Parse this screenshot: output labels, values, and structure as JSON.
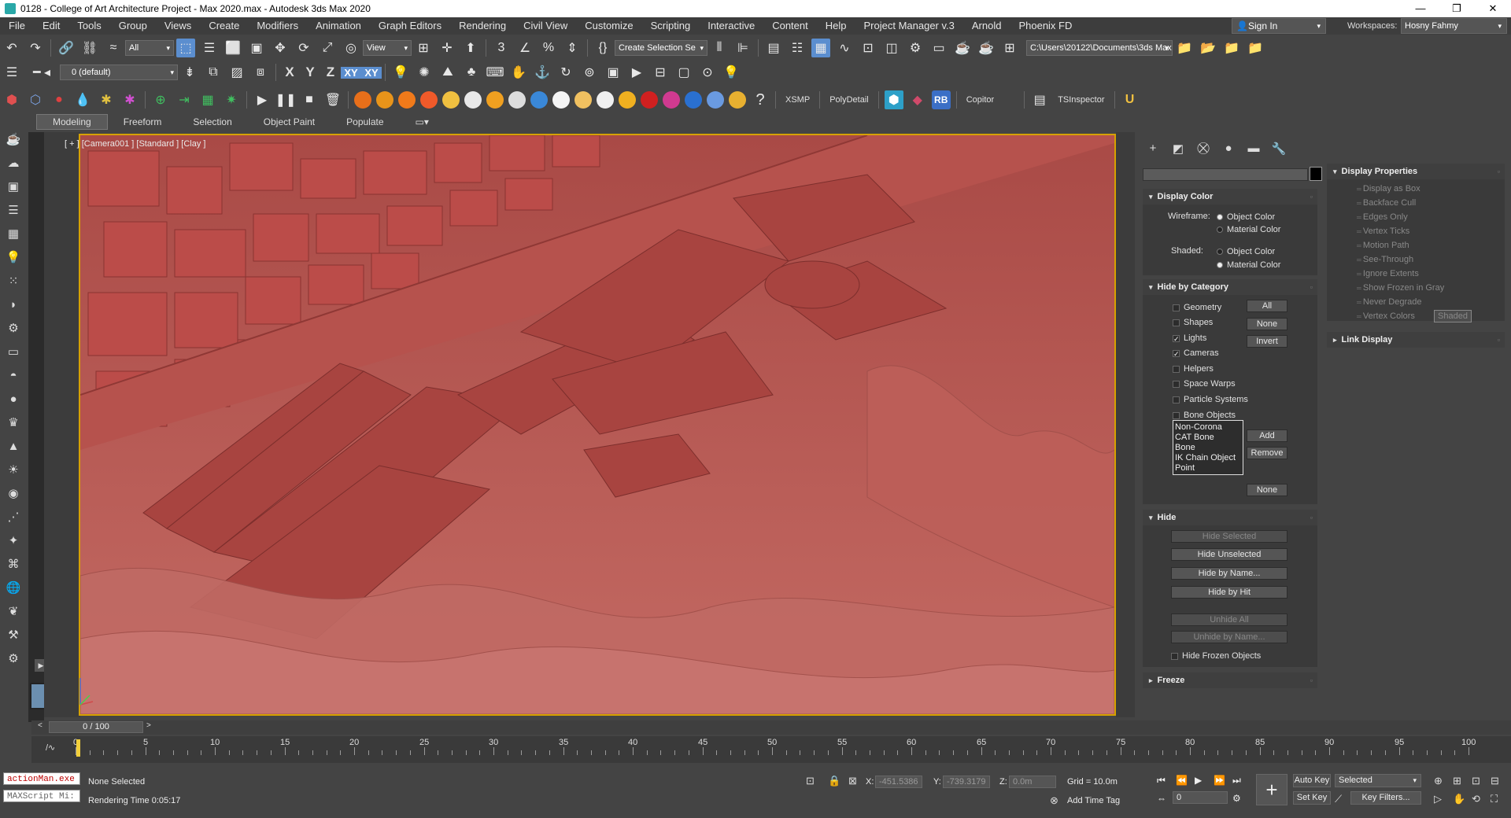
{
  "window": {
    "title": "0128 - College of Art Architecture Project - Max 2020.max - Autodesk 3ds Max 2020",
    "minimize": "—",
    "maximize": "❐",
    "close": "✕"
  },
  "menu": [
    "File",
    "Edit",
    "Tools",
    "Group",
    "Views",
    "Create",
    "Modifiers",
    "Animation",
    "Graph Editors",
    "Rendering",
    "Civil View",
    "Customize",
    "Scripting",
    "Interactive",
    "Content",
    "Help",
    "Project Manager v.3",
    "Arnold",
    "Phoenix FD"
  ],
  "account": {
    "sign_in": "Sign In",
    "workspaces_label": "Workspaces:",
    "workspace": "Hosny Fahmy"
  },
  "toolbar1": {
    "selection_filter": "All",
    "ref_coord": "View",
    "named_selection": "Create Selection Se",
    "project_path": "C:\\Users\\20122\\Documents\\3ds Max 2020"
  },
  "toolbar2": {
    "layer": "0 (default)",
    "axis_x": "X",
    "axis_y": "Y",
    "axis_z": "Z",
    "axis_xy": "XY",
    "axis_xy2": "XY"
  },
  "toolbar3": {
    "xsmp": "XSMP",
    "polydetail": "PolyDetail",
    "rb": "RB",
    "copitor": "Copitor",
    "tsinspector": "TSInspector"
  },
  "ribbon_tabs": [
    "Modeling",
    "Freeform",
    "Selection",
    "Object Paint",
    "Populate"
  ],
  "viewport": {
    "label": "[ + ] [Camera001 ] [Standard ] [Clay ]",
    "shading_color": "#b55550"
  },
  "display_color": {
    "header": "Display Color",
    "wireframe_label": "Wireframe:",
    "shaded_label": "Shaded:",
    "object_color": "Object Color",
    "material_color": "Material Color"
  },
  "hide_by_category": {
    "header": "Hide by Category",
    "items": [
      {
        "label": "Geometry",
        "checked": false
      },
      {
        "label": "Shapes",
        "checked": false
      },
      {
        "label": "Lights",
        "checked": true
      },
      {
        "label": "Cameras",
        "checked": true
      },
      {
        "label": "Helpers",
        "checked": false
      },
      {
        "label": "Space Warps",
        "checked": false
      },
      {
        "label": "Particle Systems",
        "checked": false
      },
      {
        "label": "Bone Objects",
        "checked": false
      }
    ],
    "btn_all": "All",
    "btn_none": "None",
    "btn_invert": "Invert",
    "list": [
      "Non-Corona",
      "CAT Bone",
      "Bone",
      "IK Chain Object",
      "Point"
    ],
    "btn_add": "Add",
    "btn_remove": "Remove",
    "btn_none2": "None"
  },
  "hide": {
    "header": "Hide",
    "hide_selected": "Hide Selected",
    "hide_unselected": "Hide Unselected",
    "hide_by_name": "Hide by Name...",
    "hide_by_hit": "Hide by Hit",
    "unhide_all": "Unhide All",
    "unhide_by_name": "Unhide by Name...",
    "hide_frozen": "Hide Frozen Objects"
  },
  "freeze": {
    "header": "Freeze"
  },
  "display_properties": {
    "header": "Display Properties",
    "items": [
      "Display as Box",
      "Backface Cull",
      "Edges Only",
      "Vertex Ticks",
      "Motion Path",
      "See-Through",
      "Ignore Extents",
      "Show Frozen in Gray",
      "Never Degrade",
      "Vertex Colors"
    ],
    "shaded_btn": "Shaded"
  },
  "link_display": {
    "header": "Link Display"
  },
  "timeline": {
    "frame_display": "0 / 100",
    "ticks": [
      0,
      5,
      10,
      15,
      20,
      25,
      30,
      35,
      40,
      45,
      50,
      55,
      60,
      65,
      70,
      75,
      80,
      85,
      90,
      95,
      100
    ]
  },
  "status": {
    "maxscript_line1": "actionMan.exe",
    "maxscript_line2": "MAXScript Mi:",
    "selection_status": "None Selected",
    "render_time": "Rendering Time  0:05:17",
    "x_label": "X:",
    "x_value": "-451.5386",
    "y_label": "Y:",
    "y_value": "-739.3179",
    "z_label": "Z:",
    "z_value": "0.0m",
    "grid": "Grid = 10.0m",
    "add_time_tag": "Add Time Tag",
    "auto_key": "Auto Key",
    "set_key": "Set Key",
    "selected": "Selected",
    "key_filters": "Key Filters...",
    "current_frame": "0"
  }
}
